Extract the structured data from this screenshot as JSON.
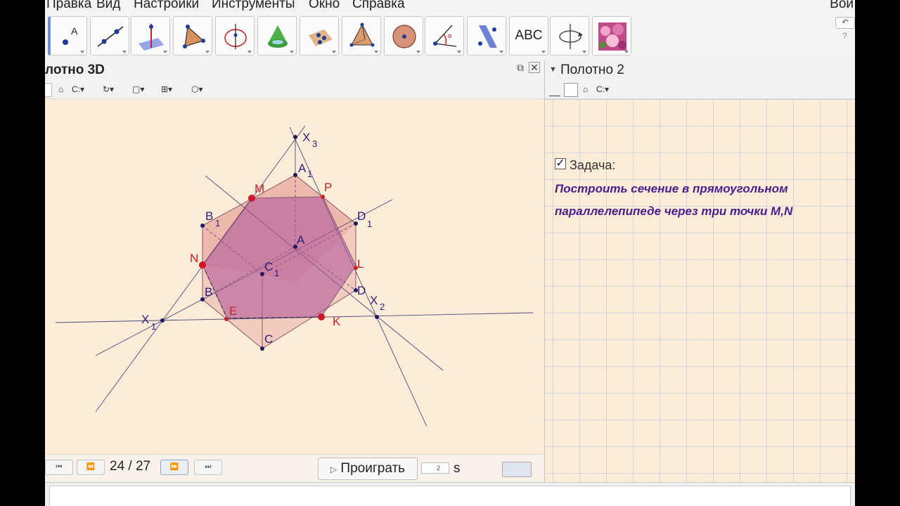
{
  "menu": {
    "items": [
      "Правка",
      "Вид",
      "Настройки",
      "Инструменты",
      "Окно",
      "Справка"
    ],
    "signin": "Вой"
  },
  "toolbar": {
    "tools": [
      {
        "name": "point-tool"
      },
      {
        "name": "line-tool"
      },
      {
        "name": "perpendicular-tool"
      },
      {
        "name": "polygon-tool"
      },
      {
        "name": "circle-tool"
      },
      {
        "name": "cone-tool"
      },
      {
        "name": "points-on-plane-tool"
      },
      {
        "name": "pyramid-tool"
      },
      {
        "name": "sphere-tool"
      },
      {
        "name": "angle-tool"
      },
      {
        "name": "reflect-tool"
      },
      {
        "name": "text-tool",
        "label": "ABC"
      },
      {
        "name": "rotate-view-tool"
      },
      {
        "name": "image-tool"
      }
    ]
  },
  "panel3d": {
    "title": "лотно 3D"
  },
  "panel2": {
    "title": "Полотно 2",
    "task_label": "Задача:",
    "task_checked": true,
    "task_lines": [
      "Построить сечение в прямоугольном",
      "параллелепипеде через три точки M,N"
    ]
  },
  "animation": {
    "page_counter": "24 / 27",
    "play_label": "Проиграть",
    "speed_value": "2",
    "speed_unit": "s"
  },
  "figure": {
    "labels": {
      "X3": "X",
      "X3_sub": "3",
      "A1": "A",
      "A1_sub": "1",
      "M": "M",
      "P": "P",
      "B1": "B",
      "B1_sub": "1",
      "D1": "D",
      "D1_sub": "1",
      "A": "A",
      "N": "N",
      "C1": "C",
      "C1_sub": "1",
      "L": "L",
      "B": "B",
      "D": "D",
      "X2": "X",
      "X2_sub": "2",
      "E": "E",
      "K": "K",
      "X1": "X",
      "X1_sub": "1",
      "C": "C"
    },
    "colors": {
      "section": "#b05a9a",
      "prism": "#e9a7a0",
      "point_red": "#d0142a",
      "point_navy": "#1f1b5e",
      "label_red": "#c8202a",
      "label_purple": "#2c1d7a"
    }
  }
}
